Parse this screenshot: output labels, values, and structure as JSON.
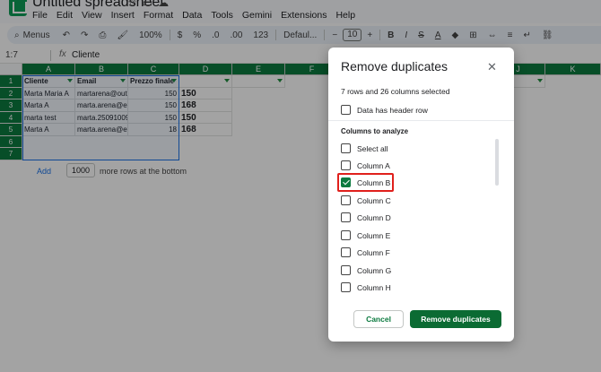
{
  "app": {
    "doc_title": "Untitled spreadsheet",
    "menu": [
      "File",
      "Edit",
      "View",
      "Insert",
      "Format",
      "Data",
      "Tools",
      "Gemini",
      "Extensions",
      "Help"
    ]
  },
  "toolbar": {
    "search_label": "Menus",
    "zoom": "100%",
    "currency": "$",
    "percent": "%",
    "dec_less": ".0",
    "dec_more": ".00",
    "format_123": "123",
    "font": "Defaul...",
    "font_size": "10",
    "bold": "B",
    "italic": "I",
    "strike": "S",
    "text_color": "A"
  },
  "formula_bar": {
    "name_box": "1:7",
    "fx": "fx",
    "content": "Cliente"
  },
  "grid": {
    "columns": [
      "A",
      "B",
      "C",
      "D",
      "E",
      "F",
      "J",
      "K"
    ],
    "rows": [
      "1",
      "2",
      "3",
      "4",
      "5",
      "6",
      "7"
    ],
    "cells": [
      [
        "Cliente",
        "Email",
        "Prezzo finale",
        ""
      ],
      [
        "Marta Maria A",
        "martarena@outl",
        "150",
        "150"
      ],
      [
        "Marta A",
        "marta.arena@ev",
        "150",
        "168"
      ],
      [
        "marta test",
        "marta.25091009",
        "150",
        "150"
      ],
      [
        "Marta A",
        "marta.arena@ev",
        "18",
        "168"
      ],
      [
        "",
        "",
        "",
        ""
      ],
      [
        "",
        "",
        "",
        ""
      ]
    ],
    "add_label": "Add",
    "rows_count": "1000",
    "rows_suffix": "more rows at the bottom"
  },
  "dialog": {
    "title": "Remove duplicates",
    "close": "✕",
    "selection_info": "7 rows and 26 columns selected",
    "header_row_label": "Data has header row",
    "header_row_checked": false,
    "section_label": "Columns to analyze",
    "options": [
      {
        "label": "Select all",
        "checked": false
      },
      {
        "label": "Column A",
        "checked": false
      },
      {
        "label": "Column B",
        "checked": true
      },
      {
        "label": "Column C",
        "checked": false
      },
      {
        "label": "Column D",
        "checked": false
      },
      {
        "label": "Column E",
        "checked": false
      },
      {
        "label": "Column F",
        "checked": false
      },
      {
        "label": "Column G",
        "checked": false
      },
      {
        "label": "Column H",
        "checked": false
      }
    ],
    "cancel_label": "Cancel",
    "remove_label": "Remove duplicates"
  },
  "colors": {
    "brand_green": "#0b7a3f",
    "highlight_red": "#e0201c",
    "link_blue": "#1a73e8"
  }
}
